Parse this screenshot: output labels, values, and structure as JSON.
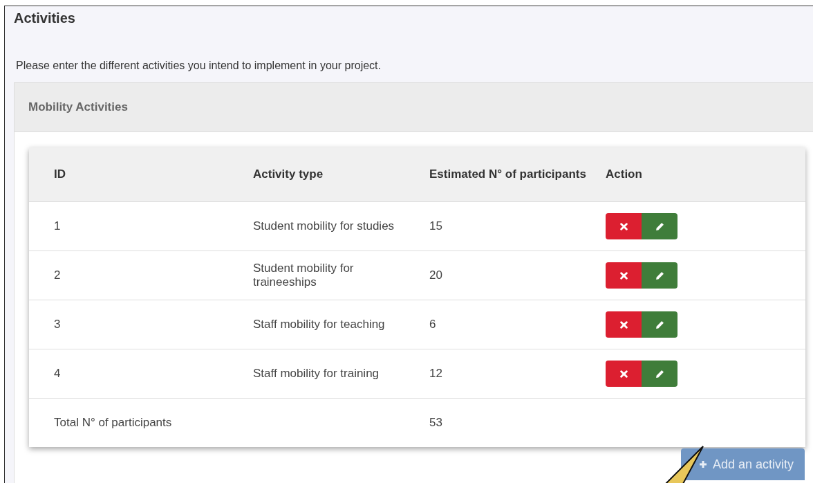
{
  "title": "Activities",
  "intro": "Please enter the different activities you intend to implement in your project.",
  "panel": {
    "title": "Mobility Activities",
    "table": {
      "columns": [
        "ID",
        "Activity type",
        "Estimated N° of participants",
        "Action"
      ],
      "rows": [
        {
          "id": "1",
          "activity_type": "Student mobility for studies",
          "participants": "15"
        },
        {
          "id": "2",
          "activity_type": "Student mobility for traineeships",
          "participants": "20"
        },
        {
          "id": "3",
          "activity_type": "Staff mobility for teaching",
          "participants": "6"
        },
        {
          "id": "4",
          "activity_type": "Staff mobility for training",
          "participants": "12"
        }
      ],
      "total": {
        "label": "Total N° of participants",
        "value": "53"
      }
    },
    "add_button": "Add an activity"
  }
}
